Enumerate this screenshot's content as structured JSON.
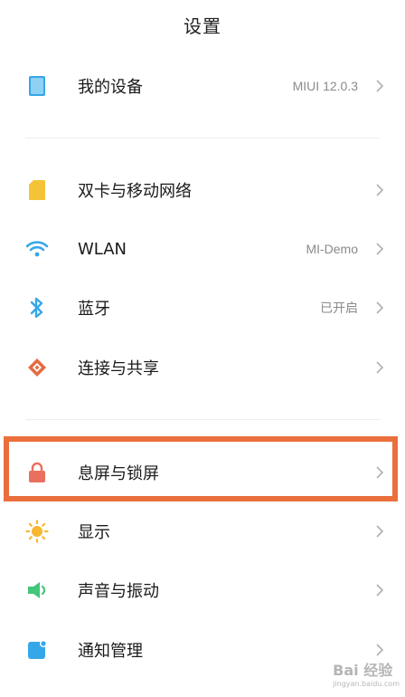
{
  "header": {
    "title": "设置"
  },
  "rows": {
    "device": {
      "label": "我的设备",
      "value": "MIUI 12.0.3",
      "icon": "tablet-icon"
    },
    "sim": {
      "label": "双卡与移动网络",
      "icon": "sim-card-icon"
    },
    "wlan": {
      "label": "WLAN",
      "value": "MI-Demo",
      "icon": "wifi-icon"
    },
    "bluetooth": {
      "label": "蓝牙",
      "value": "已开启",
      "icon": "bluetooth-icon"
    },
    "share": {
      "label": "连接与共享",
      "icon": "share-icon"
    },
    "lockscreen": {
      "label": "息屏与锁屏",
      "icon": "lock-icon"
    },
    "display": {
      "label": "显示",
      "icon": "sun-icon"
    },
    "sound": {
      "label": "声音与振动",
      "icon": "speaker-icon"
    },
    "notifications": {
      "label": "通知管理",
      "icon": "notification-icon"
    }
  },
  "watermark": {
    "brand": "Bai 经验",
    "sub": "jingyan.baidu.com"
  },
  "colors": {
    "accent_blue": "#35a7e8",
    "sim_yellow": "#f5c338",
    "share_orange": "#e46b43",
    "lock_red": "#e9705e",
    "sun_yellow": "#f7b731",
    "sound_green": "#43c57a",
    "highlight_border": "#ea6f3c"
  }
}
